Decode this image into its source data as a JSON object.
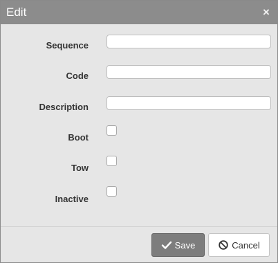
{
  "dialog": {
    "title": "Edit",
    "close_glyph": "×"
  },
  "form": {
    "fields": [
      {
        "label": "Sequence",
        "value": "",
        "type": "text"
      },
      {
        "label": "Code",
        "value": "",
        "type": "text"
      },
      {
        "label": "Description",
        "value": "",
        "type": "text"
      },
      {
        "label": "Boot",
        "checked": false,
        "type": "checkbox"
      },
      {
        "label": "Tow",
        "checked": false,
        "type": "checkbox"
      },
      {
        "label": "Inactive",
        "checked": false,
        "type": "checkbox"
      }
    ]
  },
  "footer": {
    "save_label": "Save",
    "save_icon": "check-icon",
    "cancel_label": "Cancel",
    "cancel_icon": "ban-icon"
  },
  "colors": {
    "titlebar": "#8c8c8c",
    "dialog_bg": "#e6e6e6",
    "save_button": "#7d7d7d"
  }
}
